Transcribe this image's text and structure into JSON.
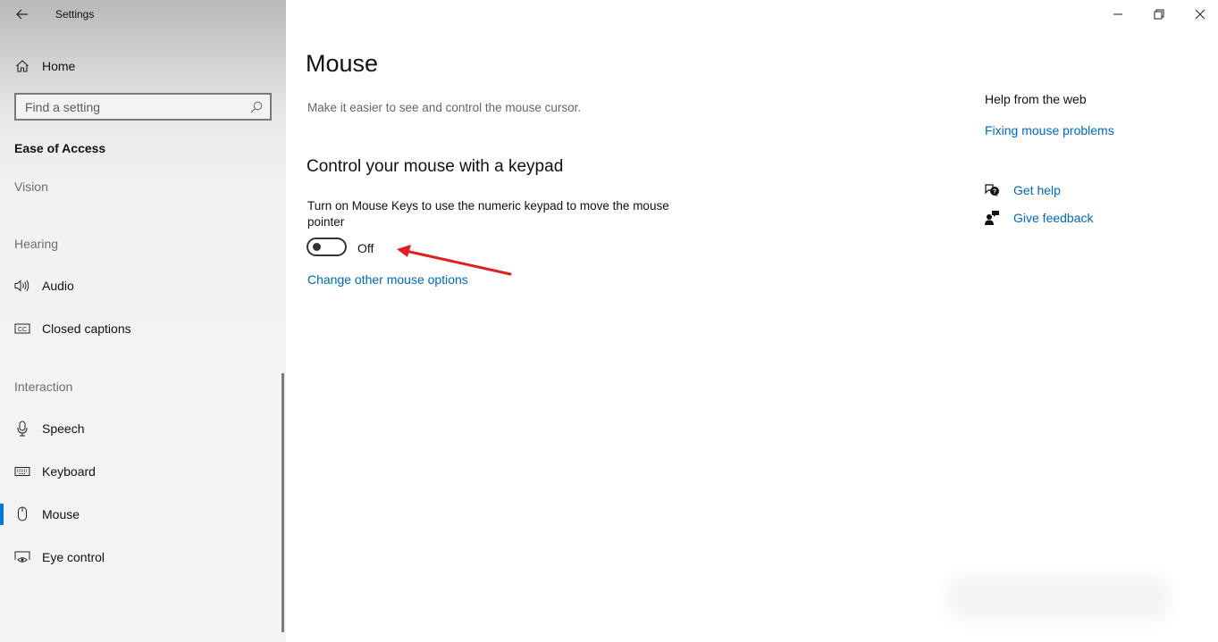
{
  "window": {
    "title": "Settings",
    "controls": {
      "minimize": "minimize-icon",
      "restore": "restore-icon",
      "close": "close-icon"
    }
  },
  "sidebar": {
    "home_label": "Home",
    "search": {
      "placeholder": "Find a setting",
      "value": ""
    },
    "section_title": "Ease of Access",
    "groups": [
      {
        "label": "Vision",
        "items": []
      },
      {
        "label": "Hearing",
        "items": [
          {
            "label": "Audio",
            "icon": "speaker-icon"
          },
          {
            "label": "Closed captions",
            "icon": "closed-captions-icon"
          }
        ]
      },
      {
        "label": "Interaction",
        "items": [
          {
            "label": "Speech",
            "icon": "microphone-icon"
          },
          {
            "label": "Keyboard",
            "icon": "keyboard-icon"
          },
          {
            "label": "Mouse",
            "icon": "mouse-icon",
            "selected": true
          },
          {
            "label": "Eye control",
            "icon": "eye-control-icon"
          }
        ]
      }
    ]
  },
  "main": {
    "title": "Mouse",
    "description": "Make it easier to see and control the mouse cursor.",
    "section_title": "Control your mouse with a keypad",
    "mouse_keys": {
      "description": "Turn on Mouse Keys to use the numeric keypad to move the mouse pointer",
      "state": "Off",
      "enabled": false
    },
    "change_link": "Change other mouse options"
  },
  "help_panel": {
    "heading": "Help from the web",
    "web_link": "Fixing mouse problems",
    "actions": [
      {
        "label": "Get help",
        "icon": "get-help-icon"
      },
      {
        "label": "Give feedback",
        "icon": "give-feedback-icon"
      }
    ]
  },
  "colors": {
    "accent": "#0078d7",
    "link": "#0067b8",
    "annotation_arrow": "#e02020"
  }
}
